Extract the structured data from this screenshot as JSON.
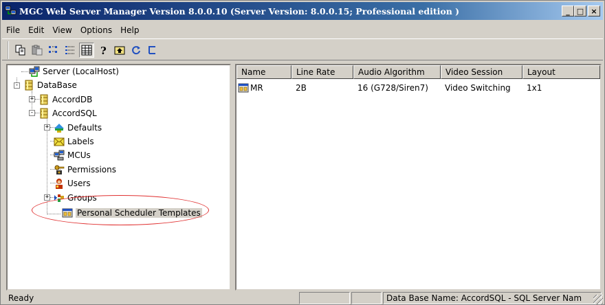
{
  "window": {
    "title": "MGC Web Server Manager Version 8.0.0.10  (Server Version: 8.0.0.15;  Professional edition )",
    "buttons": [
      "_",
      "□",
      "×"
    ]
  },
  "menu": [
    "File",
    "Edit",
    "View",
    "Options",
    "Help"
  ],
  "toolbar": {
    "buttons": [
      {
        "icon": "copy-icon"
      },
      {
        "icon": "paste-icon"
      },
      {
        "icon": "small-icons-icon"
      },
      {
        "icon": "list-icon"
      },
      {
        "icon": "details-icon",
        "pressed": true
      },
      {
        "icon": "help-icon"
      },
      {
        "icon": "up-folder-icon"
      },
      {
        "icon": "refresh-icon"
      },
      {
        "icon": "tree-view-icon"
      }
    ]
  },
  "tree": {
    "nodes": [
      {
        "label": "Server (LocalHost)",
        "icon": "server-icon"
      },
      {
        "label": "DataBase",
        "icon": "database-icon",
        "expander": "-"
      },
      {
        "label": "AccordDB",
        "icon": "database-icon",
        "expander": "+"
      },
      {
        "label": "AccordSQL",
        "icon": "database-icon",
        "expander": "-"
      },
      {
        "label": "Defaults",
        "icon": "defaults-icon",
        "expander": "+"
      },
      {
        "label": "Labels",
        "icon": "labels-icon"
      },
      {
        "label": "MCUs",
        "icon": "mcu-icon"
      },
      {
        "label": "Permissions",
        "icon": "permissions-icon"
      },
      {
        "label": "Users",
        "icon": "users-icon"
      },
      {
        "label": "Groups",
        "icon": "groups-icon",
        "expander": "+"
      },
      {
        "label": "Personal Scheduler Templates",
        "icon": "template-icon",
        "selected": true
      }
    ]
  },
  "list": {
    "columns": [
      "Name",
      "Line Rate",
      "Audio Algorithm",
      "Video Session",
      "Layout"
    ],
    "rows": [
      {
        "name": "MR",
        "icon": "template-icon",
        "line_rate": "2B",
        "audio": "16 (G728/Siren7)",
        "video": "Video Switching",
        "layout": "1x1"
      }
    ]
  },
  "status": {
    "text": "Ready",
    "db_info": "Data Base Name: AccordSQL - SQL Server Nam"
  },
  "colors": {
    "title_start": "#0a246a",
    "title_end": "#a6caf0",
    "highlight_ellipse": "#e03030"
  }
}
